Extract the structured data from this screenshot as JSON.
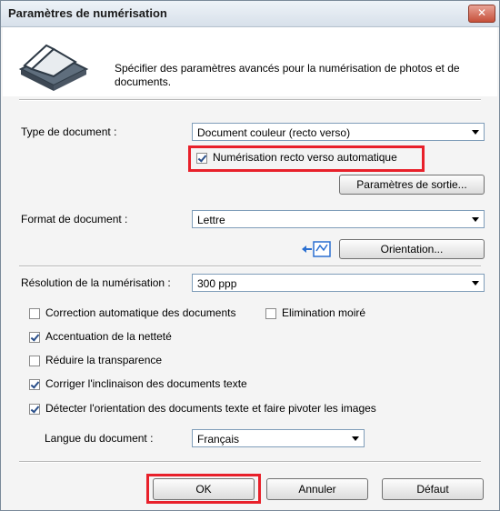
{
  "window": {
    "title": "Paramètres de numérisation",
    "close_label": "✕"
  },
  "header": {
    "icon": "scanner-icon",
    "description": "Spécifier des paramètres avancés pour la numérisation de photos et de documents."
  },
  "form": {
    "document_type": {
      "label": "Type de document :",
      "value": "Document couleur (recto verso)"
    },
    "auto_duplex": {
      "label": "Numérisation recto verso automatique",
      "checked": true
    },
    "output_settings_button": "Paramètres de sortie...",
    "document_size": {
      "label": "Format de document :",
      "value": "Lettre"
    },
    "orientation_button": "Orientation...",
    "orientation_icon": "orientation-icon",
    "resolution": {
      "label": "Résolution de la numérisation :",
      "value": "300 ppp"
    }
  },
  "options": {
    "auto_correct": {
      "label": "Correction automatique des documents",
      "checked": false
    },
    "descreen": {
      "label": "Elimination moiré",
      "checked": false
    },
    "unsharp_mask": {
      "label": "Accentuation de la netteté",
      "checked": true
    },
    "reduce_show_through": {
      "label": "Réduire la transparence",
      "checked": false
    },
    "correct_slant": {
      "label": "Corriger l'inclinaison des documents texte",
      "checked": true
    },
    "detect_orientation": {
      "label": "Détecter l'orientation des documents texte et faire pivoter les images",
      "checked": true
    },
    "language": {
      "label": "Langue du document :",
      "value": "Français"
    }
  },
  "footer": {
    "ok": "OK",
    "cancel": "Annuler",
    "default": "Défaut"
  },
  "colors": {
    "highlight": "#e8202a",
    "title_bar": "#d7e0ea",
    "dialog_bg": "#f4f4f4"
  }
}
